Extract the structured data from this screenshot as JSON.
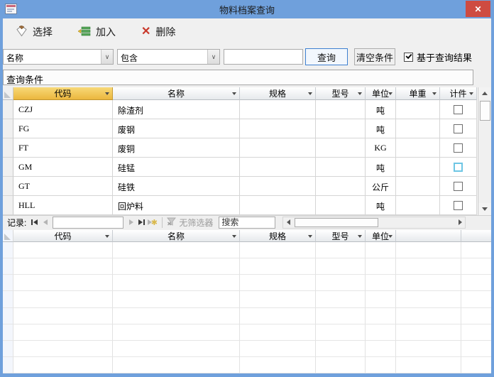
{
  "window": {
    "title": "物料档案查询",
    "close_glyph": "✕"
  },
  "toolbar": {
    "select_label": "选择",
    "add_label": "加入",
    "delete_label": "删除"
  },
  "filter": {
    "field_value": "名称",
    "operator_value": "包含",
    "keyword_value": "",
    "query_label": "查询",
    "clear_label": "清空条件",
    "result_checkbox_label": "基于查询结果",
    "result_checkbox_checked": true
  },
  "conditions": {
    "label": "查询条件"
  },
  "table1": {
    "columns": [
      "代码",
      "名称",
      "规格",
      "型号",
      "单位",
      "单重",
      "计件"
    ],
    "rows": [
      {
        "code": "CZJ",
        "name": "除渣剂",
        "spec": "",
        "model": "",
        "unit": "吨",
        "weight": "",
        "piece": false
      },
      {
        "code": "FG",
        "name": "废钢",
        "spec": "",
        "model": "",
        "unit": "吨",
        "weight": "",
        "piece": false
      },
      {
        "code": "FT",
        "name": "废铜",
        "spec": "",
        "model": "",
        "unit": "KG",
        "weight": "",
        "piece": false
      },
      {
        "code": "GM",
        "name": "硅锰",
        "spec": "",
        "model": "",
        "unit": "吨",
        "weight": "",
        "piece": false
      },
      {
        "code": "GT",
        "name": "硅铁",
        "spec": "",
        "model": "",
        "unit": "公斤",
        "weight": "",
        "piece": false
      },
      {
        "code": "HLL",
        "name": "回炉料",
        "spec": "",
        "model": "",
        "unit": "吨",
        "weight": "",
        "piece": false
      }
    ]
  },
  "nav": {
    "record_label": "记录:",
    "record_value": "",
    "filter_label": "无筛选器",
    "search_placeholder": "搜索"
  },
  "table2": {
    "columns": [
      "代码",
      "名称",
      "规格",
      "型号",
      "单位"
    ]
  },
  "colors": {
    "titlebar": "#6FA0DC",
    "close_button": "#CE4B41",
    "selected_header": "#EBB73E",
    "query_button_border": "#3E80D0",
    "focused_checkbox": "#6EC6E4"
  }
}
